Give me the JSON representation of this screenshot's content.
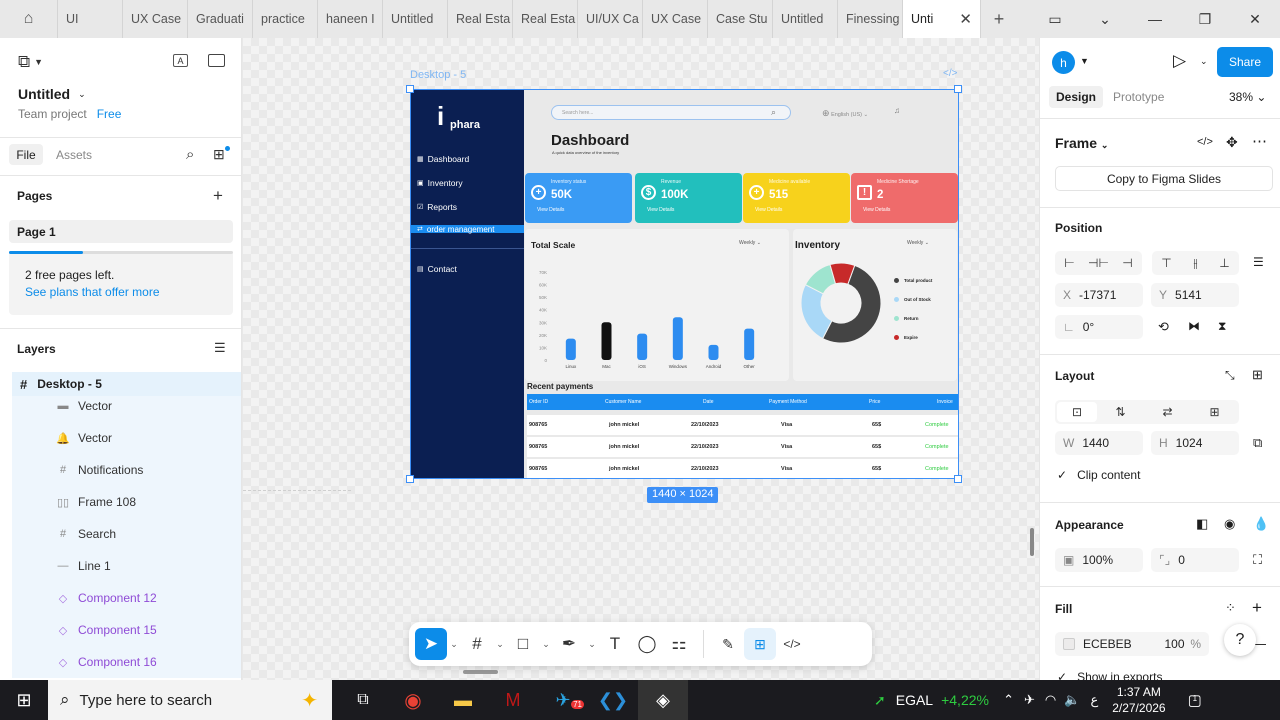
{
  "tabs": [
    "UI",
    "UX Case",
    "Graduati",
    "practice",
    "haneen I",
    "Untitled",
    "Real Esta",
    "Real Esta",
    "UI/UX Ca",
    "UX Case",
    "Case Stu",
    "Untitled",
    "Finessing",
    "Unti"
  ],
  "file": {
    "name": "Untitled",
    "project": "Team project",
    "plan": "Free"
  },
  "left_tabs": {
    "file": "File",
    "assets": "Assets"
  },
  "pages": {
    "title": "Pages",
    "page1": "Page 1",
    "free_left": "2 free pages left.",
    "see_plans": "See plans that offer more"
  },
  "layers": {
    "title": "Layers",
    "root": "Desktop - 5",
    "items": [
      {
        "name": "Vector",
        "kind": "rect"
      },
      {
        "name": "Vector",
        "kind": "bell"
      },
      {
        "name": "Notifications",
        "kind": "frame"
      },
      {
        "name": "Frame 108",
        "kind": "auto"
      },
      {
        "name": "Search",
        "kind": "frame"
      },
      {
        "name": "Line 1",
        "kind": "line"
      },
      {
        "name": "Component 12",
        "kind": "comp"
      },
      {
        "name": "Component 15",
        "kind": "comp"
      },
      {
        "name": "Component 16",
        "kind": "comp"
      }
    ]
  },
  "canvas": {
    "frame_label": "Desktop - 5",
    "size_badge": "1440 × 1024"
  },
  "design": {
    "brand": "phara",
    "brand_letter": "i",
    "search_placeholder": "Search here...",
    "language": "English (US)",
    "title": "Dashboard",
    "subtitle": "A quick data overview of the inventory",
    "nav": [
      "Dashboard",
      "Inventory",
      "Reports",
      "order management",
      "Contact"
    ],
    "cards": [
      {
        "title": "Inventory status",
        "value": "50K",
        "link": "View Details",
        "color": "#3a9bf4",
        "icon": "+"
      },
      {
        "title": "Revenue",
        "value": "100K",
        "link": "View Details",
        "color": "#22bfbd",
        "icon": "$"
      },
      {
        "title": "Medicine available",
        "value": "515",
        "link": "View Details",
        "color": "#f7d21c",
        "icon": "+"
      },
      {
        "title": "Medicine Shortage",
        "value": "2",
        "link": "View Details",
        "color": "#ef6b6b",
        "icon": "!"
      }
    ],
    "total_scale": {
      "title": "Total Scale",
      "period": "Weekly"
    },
    "inventory": {
      "title": "Inventory",
      "period": "Weekly",
      "legend": [
        {
          "label": "Total product",
          "color": "#444444"
        },
        {
          "label": "Out of Stock",
          "color": "#a9d8f7"
        },
        {
          "label": "Return",
          "color": "#9ee4cf"
        },
        {
          "label": "Expire",
          "color": "#c72a2a"
        }
      ]
    },
    "payments": {
      "title": "Recent payments",
      "headers": [
        "Order ID",
        "Customer Name",
        "Date",
        "Payment Method",
        "Price",
        "Invoice"
      ],
      "rows": [
        [
          "908765",
          "john mickel",
          "22/10/2023",
          "Visa",
          "65$",
          "Complete"
        ],
        [
          "908765",
          "john mickel",
          "22/10/2023",
          "Visa",
          "65$",
          "Complete"
        ],
        [
          "908765",
          "john mickel",
          "22/10/2023",
          "Visa",
          "65$",
          "Complete"
        ]
      ]
    }
  },
  "chart_data": [
    {
      "type": "bar",
      "title": "Total Scale",
      "categories": [
        "Linux",
        "Mac",
        "iOS",
        "Windows",
        "Android",
        "Other"
      ],
      "values": [
        17,
        30,
        21,
        34,
        12,
        25
      ],
      "ytick_labels": [
        "0",
        "10K",
        "20K",
        "30K",
        "40K",
        "50K",
        "60K",
        "70K"
      ],
      "ylim": [
        0,
        70
      ],
      "colors": [
        "#2d8cf0",
        "#111111",
        "#2d8cf0",
        "#2d8cf0",
        "#2d8cf0",
        "#2d8cf0"
      ]
    },
    {
      "type": "pie",
      "title": "Inventory",
      "labels": [
        "Total product",
        "Out of Stock",
        "Return",
        "Expire"
      ],
      "values": [
        52,
        25,
        13,
        10
      ],
      "colors": [
        "#444444",
        "#a9d8f7",
        "#9ee4cf",
        "#c72a2a"
      ]
    }
  ],
  "right": {
    "avatar": "h",
    "share": "Share",
    "tab_design": "Design",
    "tab_prototype": "Prototype",
    "zoom": "38%",
    "frame": "Frame",
    "copy_slides": "Copy to Figma Slides",
    "position": "Position",
    "x_label": "X",
    "x": "-17371",
    "y_label": "Y",
    "y": "5141",
    "rotation": "0°",
    "layout": "Layout",
    "w_label": "W",
    "w": "1440",
    "h_label": "H",
    "h": "1024",
    "clip": "Clip content",
    "appearance": "Appearance",
    "opacity": "100%",
    "radius": "0",
    "fill": "Fill",
    "fill_hex": "ECEBEB",
    "fill_opacity": "100",
    "percent": "%",
    "show_exports": "Show in exports",
    "help": "?"
  },
  "taskbar": {
    "search": "Type here to search",
    "stock_name": "EGAL",
    "stock_change": "+4,22%",
    "time": "1:37 AM",
    "date": "2/27/2026",
    "lang": "ع",
    "notif": "1",
    "tg_badge": "71"
  }
}
